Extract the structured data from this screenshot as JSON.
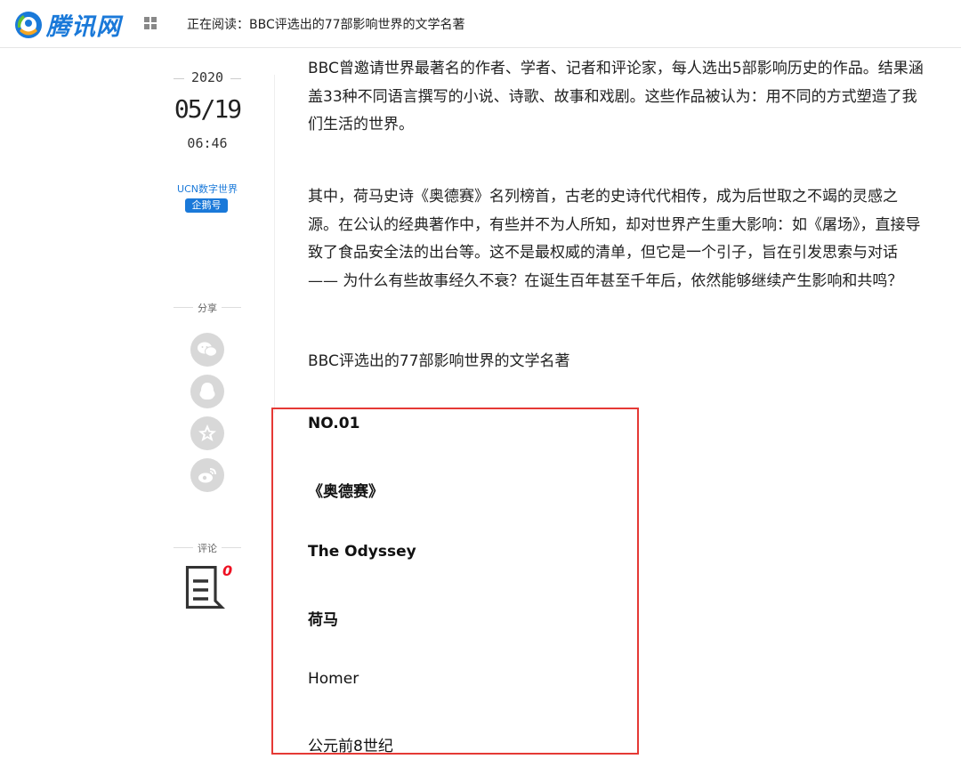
{
  "header": {
    "logo_text": "腾讯网",
    "reading_label": "正在阅读：BBC评选出的77部影响世界的文学名著"
  },
  "meta": {
    "year": "2020",
    "month_day": "05/19",
    "time": "06:46",
    "author": "UCN数字世界",
    "author_badge": "企鹅号"
  },
  "share": {
    "label": "分享",
    "buttons": [
      "wechat-icon",
      "qq-icon",
      "qzone-icon",
      "weibo-icon"
    ]
  },
  "comment": {
    "label": "评论",
    "count": "0"
  },
  "article": {
    "paragraphs": [
      "BBC曾邀请世界最著名的作者、学者、记者和评论家，每人选出5部影响历史的作品。结果涵盖33种不同语言撰写的小说、诗歌、故事和戏剧。这些作品被认为：用不同的方式塑造了我们生活的世界。",
      "其中，荷马史诗《奥德赛》名列榜首，古老的史诗代代相传，成为后世取之不竭的灵感之源。在公认的经典著作中，有些并不为人所知，却对世界产生重大影响：如《屠场》，直接导致了食品安全法的出台等。这不是最权威的清单，但它是一个引子，旨在引发思索与对话—— 为什么有些故事经久不衰？在诞生百年甚至千年后，依然能够继续产生影响和共鸣？",
      "BBC评选出的77部影响世界的文学名著"
    ],
    "entry": {
      "number": "NO.01",
      "title_cn": "《奥德赛》",
      "title_en": "The Odyssey",
      "author_cn": "荷马",
      "author_en": "Homer",
      "era": "公元前8世纪"
    }
  },
  "colors": {
    "brand": "#1a79d9",
    "highlight_border": "#e53935"
  }
}
